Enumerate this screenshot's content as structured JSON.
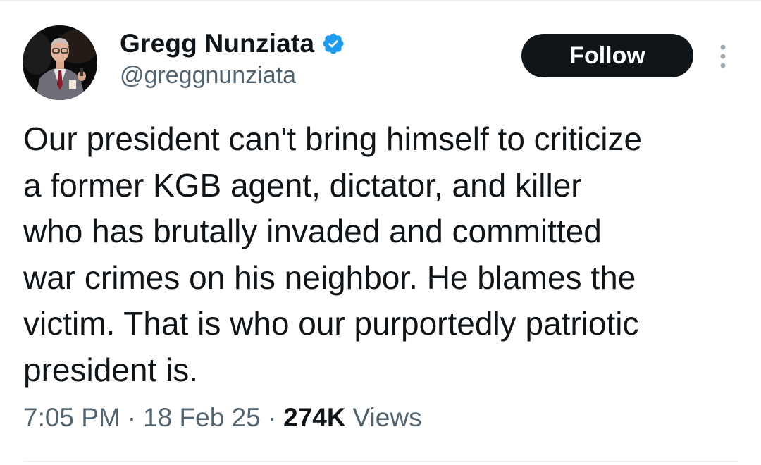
{
  "author": {
    "display_name": "Gregg Nunziata",
    "handle": "@greggnunziata",
    "verified": true,
    "avatar_icon": "profile-photo"
  },
  "actions": {
    "follow_label": "Follow",
    "more_icon": "vertical-ellipsis-icon"
  },
  "tweet": {
    "text": "Our president can't bring himself to criticize\na former KGB agent, dictator, and killer\nwho has brutally invaded and committed\nwar crimes on his neighbor. He blames the\nvictim. That is who our purportedly patriotic\npresident is.",
    "time": "7:05 PM",
    "date": "18 Feb 25",
    "separator": "·",
    "views_count": "274K",
    "views_label": "Views"
  },
  "colors": {
    "text_primary": "#0f1419",
    "text_secondary": "#536471",
    "verified_blue": "#1d9bf0",
    "follow_bg": "#0f1419",
    "divider": "#eff3f4"
  }
}
